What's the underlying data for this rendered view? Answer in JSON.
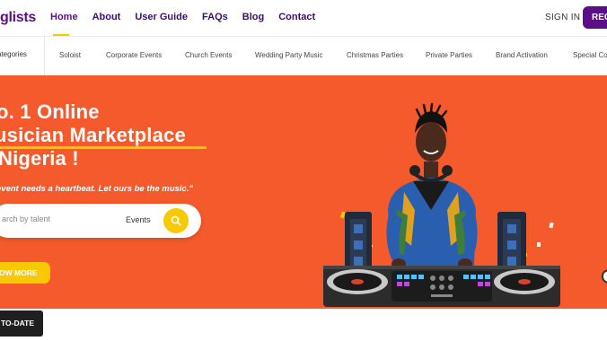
{
  "header": {
    "logo": "glists",
    "nav": [
      "Home",
      "About",
      "User Guide",
      "FAQs",
      "Blog",
      "Contact"
    ],
    "sign_in": "SIGN IN",
    "register": "REG"
  },
  "categories": {
    "first": "ategories",
    "items": [
      "Soloist",
      "Corporate Events",
      "Church Events",
      "Wedding Party Music",
      "Christmas Parties",
      "Private Parties",
      "Brand Activation",
      "Special Col"
    ]
  },
  "hero": {
    "title_line1": "o. 1 Online",
    "title_line2": "usician Marketplace",
    "title_line3": " Nigeria !",
    "tagline": "event needs a heartbeat. Let ours be the music.\"",
    "search_placeholder": "arch by talent",
    "search_select": "Events",
    "know_more": "OW MORE",
    "colors": {
      "background": "#f55a2c",
      "accent": "#f6c900",
      "brand": "#5a0f86"
    }
  },
  "footer": {
    "up_to_date": "TO-DATE"
  },
  "icons": [
    "search-icon",
    "chevron-down-icon"
  ]
}
